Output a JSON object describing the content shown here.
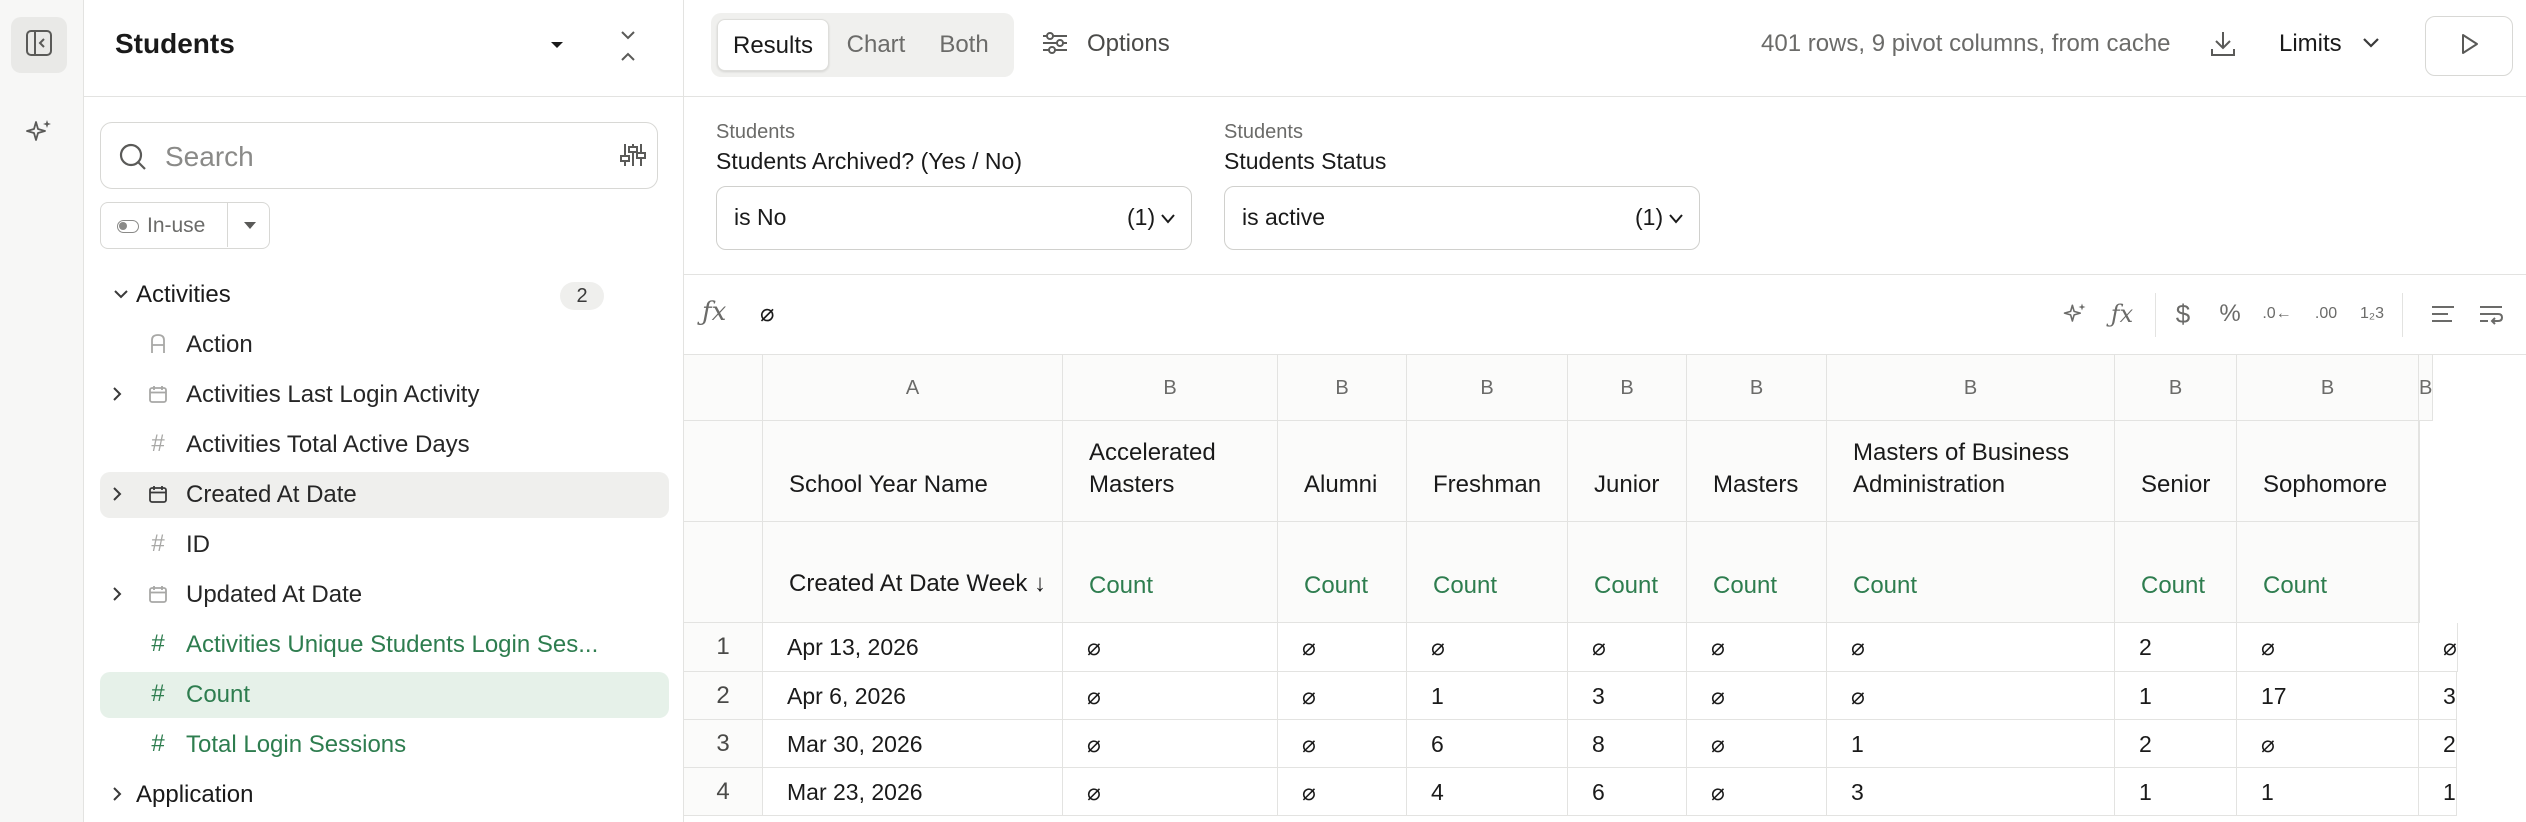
{
  "sidebar": {
    "title": "Students",
    "search_placeholder": "Search",
    "inuse_label": "In-use",
    "tree": [
      {
        "label": "Activities",
        "badge": "2"
      },
      {
        "label": "Action"
      },
      {
        "label": "Activities Last Login Activity"
      },
      {
        "label": "Activities Total Active Days"
      },
      {
        "label": "Created At Date"
      },
      {
        "label": "ID"
      },
      {
        "label": "Updated At Date"
      },
      {
        "label": "Activities Unique Students Login Ses..."
      },
      {
        "label": "Count"
      },
      {
        "label": "Total Login Sessions"
      },
      {
        "label": "Application"
      }
    ]
  },
  "toolbar": {
    "tabs": [
      "Results",
      "Chart",
      "Both"
    ],
    "options_label": "Options",
    "row_info": "401 rows, 9 pivot columns, from cache",
    "limits_label": "Limits"
  },
  "filters": [
    {
      "category": "Students",
      "name": "Students Archived? (Yes / No)",
      "value": "is No",
      "count": "(1)"
    },
    {
      "category": "Students",
      "name": "Students Status",
      "value": "is active",
      "count": "(1)"
    }
  ],
  "formula": {
    "value": "⌀"
  },
  "grid": {
    "letters": [
      "A",
      "B",
      "B",
      "B",
      "B",
      "B",
      "B",
      "B",
      "B",
      "B"
    ],
    "pivot_headers": [
      "School Year Name",
      "Accelerated Masters",
      "Alumni",
      "Freshman",
      "Junior",
      "Masters",
      "Masters of Business Administration",
      "Senior",
      "Sophomore",
      "⌀"
    ],
    "dimension_header": "Created At Date Week ↓",
    "measure_label": "Count",
    "rows": [
      {
        "n": "1",
        "date": "Apr 13, 2026",
        "vals": [
          "⌀",
          "⌀",
          "⌀",
          "⌀",
          "⌀",
          "⌀",
          "2",
          "⌀",
          "⌀"
        ]
      },
      {
        "n": "2",
        "date": "Apr 6, 2026",
        "vals": [
          "⌀",
          "⌀",
          "1",
          "3",
          "⌀",
          "⌀",
          "1",
          "17",
          "3"
        ]
      },
      {
        "n": "3",
        "date": "Mar 30, 2026",
        "vals": [
          "⌀",
          "⌀",
          "6",
          "8",
          "⌀",
          "1",
          "2",
          "⌀",
          "2"
        ]
      },
      {
        "n": "4",
        "date": "Mar 23, 2026",
        "vals": [
          "⌀",
          "⌀",
          "4",
          "6",
          "⌀",
          "3",
          "1",
          "1",
          "1"
        ]
      }
    ]
  }
}
